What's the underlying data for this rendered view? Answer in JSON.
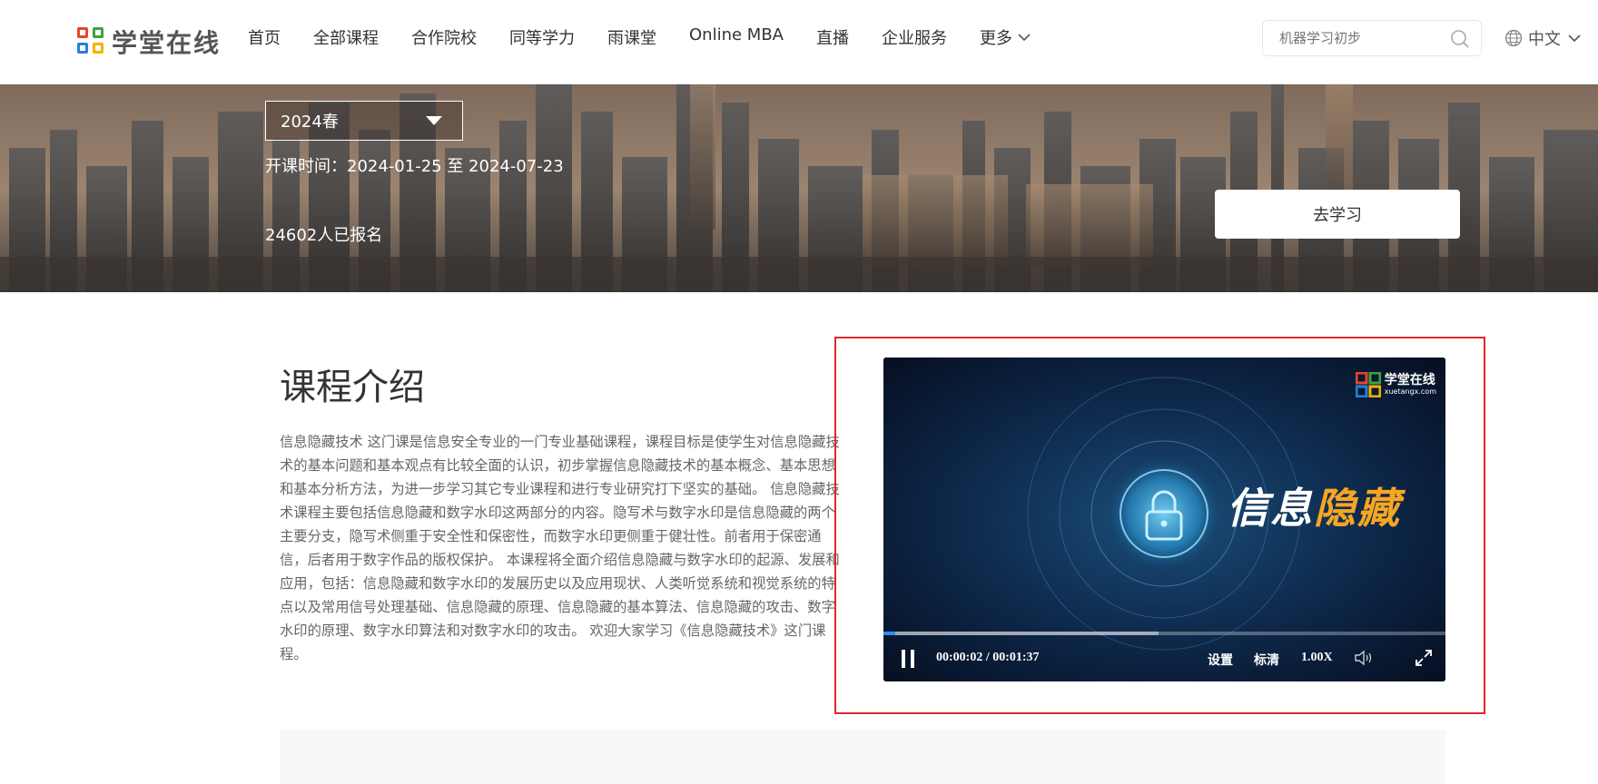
{
  "header": {
    "logo_text": "学堂在线",
    "nav": [
      "首页",
      "全部课程",
      "合作院校",
      "同等学力",
      "雨课堂",
      "Online MBA",
      "直播",
      "企业服务"
    ],
    "more_label": "更多",
    "search_placeholder": "机器学习初步",
    "language": "中文"
  },
  "banner": {
    "term": "2024春",
    "dates": "开课时间：2024-01-25 至 2024-07-23",
    "enrolled": "24602人已报名",
    "study_button": "去学习"
  },
  "intro": {
    "title": "课程介绍",
    "text": "信息隐藏技术 这门课是信息安全专业的一门专业基础课程，课程目标是使学生对信息隐藏技术的基本问题和基本观点有比较全面的认识，初步掌握信息隐藏技术的基本概念、基本思想和基本分析方法，为进一步学习其它专业课程和进行专业研究打下坚实的基础。 信息隐藏技术课程主要包括信息隐藏和数字水印这两部分的内容。隐写术与数字水印是信息隐藏的两个主要分支，隐写术侧重于安全性和保密性，而数字水印更侧重于健壮性。前者用于保密通信，后者用于数字作品的版权保护。 本课程将全面介绍信息隐藏与数字水印的起源、发展和应用，包括：信息隐藏和数字水印的发展历史以及应用现状、人类听觉系统和视觉系统的特点以及常用信号处理基础、信息隐藏的原理、信息隐藏的基本算法、信息隐藏的攻击、数字水印的原理、数字水印算法和对数字水印的攻击。 欢迎大家学习《信息隐藏技术》这门课程。"
  },
  "video": {
    "watermark_cn": "学堂在线",
    "watermark_en": "xuetangx.com",
    "title_white": "信息",
    "title_orange": "隐藏",
    "current_time": "00:00:02",
    "duration": "00:01:37",
    "time_display": "00:00:02 / 00:01:37",
    "settings_label": "设置",
    "quality_label": "标清",
    "speed_label": "1.00X",
    "played_fraction": 0.021,
    "buffered_fraction": 0.49
  },
  "colors": {
    "highlight_border": "#e0272b",
    "title_accent": "#f5a623",
    "progress_played": "#2b8cf6"
  }
}
